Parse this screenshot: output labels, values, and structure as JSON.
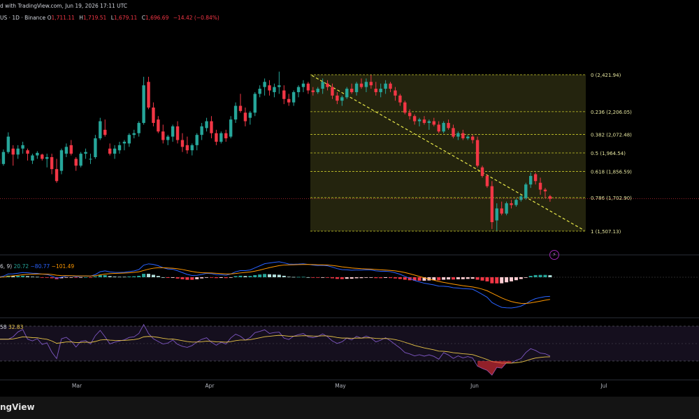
{
  "header": {
    "published": "d with TradingView.com, Jun 19, 2026 17:11 UTC",
    "symbol": "US · 1D · Binance",
    "o_label": "O",
    "o_value": "1,711.11",
    "h_label": "H",
    "h_value": "1,719.51",
    "l_label": "L",
    "l_value": "1,679.11",
    "c_label": "C",
    "c_value": "1,696.69",
    "change": "−14.42 (−0.84%)"
  },
  "macd": {
    "params": "6, 9)",
    "histogram": "20.72",
    "macd": "−80.77",
    "signal": "−101.49"
  },
  "rsi": {
    "params": "58",
    "value": "32.83"
  },
  "footer": {
    "brand": "ngView"
  },
  "colors": {
    "up": "#26a69a",
    "down": "#f23645",
    "fib": "#c9c92b",
    "fib_fill": "#2a2a10",
    "macd_line": "#2962ff",
    "signal_line": "#ff9800",
    "rsi_line": "#7e57c2",
    "rsi_ma": "#e8c547"
  },
  "chart_data": {
    "type": "candlestick",
    "x_tick_labels": [
      "Mar",
      "Apr",
      "May",
      "Jun",
      "Jul"
    ],
    "fib_levels": [
      {
        "ratio": "0",
        "price": 2421.94
      },
      {
        "ratio": "0.236",
        "price": 2206.05
      },
      {
        "ratio": "0.382",
        "price": 2072.48
      },
      {
        "ratio": "0.5",
        "price": 1964.54
      },
      {
        "ratio": "0.618",
        "price": 1856.59
      },
      {
        "ratio": "0.786",
        "price": 1702.9
      },
      {
        "ratio": "1",
        "price": 1507.13
      }
    ],
    "last_price": 1696.69,
    "candles": [
      [
        1,
        1930,
        1960,
        1880,
        1900
      ],
      [
        2,
        1900,
        1985,
        1890,
        1970
      ],
      [
        3,
        1970,
        2085,
        1960,
        2060
      ],
      [
        4,
        1990,
        2010,
        1890,
        1955
      ],
      [
        5,
        1955,
        2010,
        1930,
        1990
      ],
      [
        6,
        1990,
        2030,
        1960,
        2010
      ],
      [
        7,
        1980,
        1990,
        1920,
        1960
      ],
      [
        8,
        1920,
        1960,
        1900,
        1950
      ],
      [
        9,
        1950,
        1975,
        1930,
        1965
      ],
      [
        10,
        1955,
        1960,
        1920,
        1930
      ],
      [
        11,
        1930,
        1960,
        1880,
        1940
      ],
      [
        12,
        1940,
        1960,
        1840,
        1870
      ],
      [
        13,
        1870,
        1930,
        1790,
        1800
      ],
      [
        14,
        1860,
        1990,
        1840,
        1980
      ],
      [
        15,
        1960,
        2020,
        1940,
        2000
      ],
      [
        16,
        2010,
        2040,
        1950,
        1960
      ],
      [
        17,
        1930,
        1940,
        1860,
        1890
      ],
      [
        18,
        1890,
        1970,
        1880,
        1960
      ],
      [
        19,
        1960,
        1990,
        1930,
        1970
      ],
      [
        20,
        1930,
        1960,
        1900,
        1930
      ],
      [
        21,
        1940,
        2070,
        1930,
        2050
      ],
      [
        22,
        2050,
        2170,
        2040,
        2150
      ],
      [
        23,
        2100,
        2160,
        2060,
        2070
      ],
      [
        24,
        1990,
        2020,
        1950,
        1960
      ],
      [
        25,
        1960,
        2010,
        1930,
        1990
      ],
      [
        26,
        1980,
        2030,
        1960,
        2010
      ],
      [
        27,
        2020,
        2040,
        1980,
        2030
      ],
      [
        28,
        2020,
        2080,
        2000,
        2070
      ],
      [
        29,
        2070,
        2100,
        2050,
        2080
      ],
      [
        30,
        2080,
        2150,
        2060,
        2140
      ],
      [
        31,
        2140,
        2410,
        2130,
        2360
      ],
      [
        32,
        2380,
        2410,
        2220,
        2230
      ],
      [
        33,
        2230,
        2260,
        2120,
        2140
      ],
      [
        34,
        2160,
        2180,
        2080,
        2090
      ],
      [
        35,
        2090,
        2130,
        2020,
        2040
      ],
      [
        36,
        2040,
        2070,
        2010,
        2060
      ],
      [
        37,
        2060,
        2130,
        2030,
        2120
      ],
      [
        38,
        2120,
        2150,
        2020,
        2040
      ],
      [
        39,
        2040,
        2080,
        1970,
        2000
      ],
      [
        40,
        2010,
        2060,
        1960,
        1980
      ],
      [
        41,
        1980,
        2020,
        1950,
        2010
      ],
      [
        42,
        2010,
        2080,
        1980,
        2070
      ],
      [
        43,
        2070,
        2140,
        2040,
        2120
      ],
      [
        44,
        2110,
        2170,
        2090,
        2150
      ],
      [
        45,
        2150,
        2180,
        2050,
        2080
      ],
      [
        46,
        2080,
        2100,
        2010,
        2030
      ],
      [
        47,
        2030,
        2090,
        2020,
        2080
      ],
      [
        48,
        2080,
        2100,
        2030,
        2050
      ],
      [
        49,
        2060,
        2180,
        2050,
        2160
      ],
      [
        50,
        2160,
        2260,
        2140,
        2240
      ],
      [
        51,
        2240,
        2310,
        2200,
        2210
      ],
      [
        52,
        2200,
        2230,
        2120,
        2150
      ],
      [
        53,
        2170,
        2210,
        2130,
        2200
      ],
      [
        54,
        2200,
        2320,
        2180,
        2310
      ],
      [
        55,
        2310,
        2360,
        2290,
        2340
      ],
      [
        56,
        2350,
        2400,
        2300,
        2380
      ],
      [
        57,
        2360,
        2390,
        2300,
        2330
      ],
      [
        58,
        2320,
        2370,
        2290,
        2350
      ],
      [
        59,
        2350,
        2440,
        2310,
        2360
      ],
      [
        60,
        2330,
        2360,
        2250,
        2280
      ],
      [
        61,
        2280,
        2310,
        2240,
        2260
      ],
      [
        62,
        2260,
        2330,
        2240,
        2320
      ],
      [
        63,
        2320,
        2360,
        2290,
        2350
      ],
      [
        64,
        2350,
        2390,
        2320,
        2370
      ],
      [
        65,
        2370,
        2380,
        2310,
        2330
      ],
      [
        66,
        2330,
        2350,
        2300,
        2320
      ],
      [
        67,
        2320,
        2350,
        2310,
        2340
      ],
      [
        68,
        2340,
        2400,
        2310,
        2380
      ],
      [
        69,
        2370,
        2390,
        2330,
        2350
      ],
      [
        70,
        2350,
        2370,
        2280,
        2300
      ],
      [
        71,
        2300,
        2320,
        2250,
        2270
      ],
      [
        72,
        2270,
        2300,
        2240,
        2290
      ],
      [
        73,
        2290,
        2350,
        2280,
        2340
      ],
      [
        74,
        2340,
        2370,
        2310,
        2320
      ],
      [
        75,
        2320,
        2380,
        2300,
        2370
      ],
      [
        76,
        2370,
        2400,
        2340,
        2350
      ],
      [
        77,
        2350,
        2400,
        2320,
        2380
      ],
      [
        78,
        2380,
        2420,
        2340,
        2360
      ],
      [
        79,
        2340,
        2380,
        2300,
        2320
      ],
      [
        80,
        2320,
        2370,
        2290,
        2340
      ],
      [
        81,
        2340,
        2390,
        2310,
        2370
      ],
      [
        82,
        2370,
        2380,
        2320,
        2340
      ],
      [
        83,
        2330,
        2350,
        2270,
        2300
      ],
      [
        84,
        2300,
        2310,
        2240,
        2260
      ],
      [
        85,
        2260,
        2270,
        2190,
        2200
      ],
      [
        86,
        2200,
        2220,
        2160,
        2180
      ],
      [
        87,
        2180,
        2190,
        2130,
        2150
      ],
      [
        88,
        2150,
        2170,
        2120,
        2160
      ],
      [
        89,
        2160,
        2180,
        2130,
        2140
      ],
      [
        90,
        2140,
        2160,
        2100,
        2150
      ],
      [
        91,
        2150,
        2170,
        2120,
        2130
      ],
      [
        92,
        2130,
        2150,
        2080,
        2090
      ],
      [
        93,
        2090,
        2150,
        2080,
        2140
      ],
      [
        94,
        2140,
        2160,
        2100,
        2110
      ],
      [
        95,
        2110,
        2130,
        2050,
        2060
      ],
      [
        96,
        2060,
        2090,
        2040,
        2080
      ],
      [
        97,
        2080,
        2100,
        2040,
        2050
      ],
      [
        98,
        2050,
        2070,
        2040,
        2060
      ],
      [
        99,
        2060,
        2070,
        2020,
        2040
      ],
      [
        100,
        2040,
        2060,
        1880,
        1890
      ],
      [
        101,
        1880,
        1890,
        1820,
        1830
      ],
      [
        102,
        1830,
        1840,
        1760,
        1770
      ],
      [
        103,
        1770,
        1800,
        1520,
        1560
      ],
      [
        104,
        1570,
        1670,
        1510,
        1640
      ],
      [
        105,
        1640,
        1680,
        1600,
        1610
      ],
      [
        106,
        1610,
        1680,
        1600,
        1670
      ],
      [
        107,
        1670,
        1690,
        1640,
        1660
      ],
      [
        108,
        1660,
        1700,
        1650,
        1690
      ],
      [
        109,
        1690,
        1720,
        1680,
        1710
      ],
      [
        110,
        1700,
        1790,
        1690,
        1780
      ],
      [
        111,
        1780,
        1850,
        1760,
        1830
      ],
      [
        112,
        1840,
        1850,
        1780,
        1800
      ],
      [
        113,
        1790,
        1820,
        1720,
        1750
      ],
      [
        114,
        1750,
        1760,
        1700,
        1740
      ],
      [
        115,
        1711.11,
        1719.51,
        1679.11,
        1696.69
      ]
    ]
  }
}
